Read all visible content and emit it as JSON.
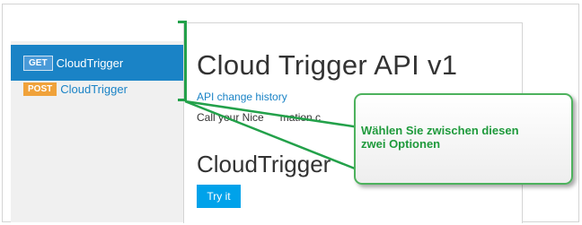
{
  "sidebar": {
    "items": [
      {
        "method": "GET",
        "label": "CloudTrigger"
      },
      {
        "method": "POST",
        "label": "CloudTrigger"
      }
    ]
  },
  "main": {
    "title": "Cloud Trigger API v1",
    "history_link": "API change history",
    "description_visible": "Call your Nice",
    "description_tail": "mation c",
    "operation_title": "CloudTrigger",
    "try_button": "Try it"
  },
  "callout": {
    "line1": "Wählen Sie zwischen diesen",
    "line2": "zwei Optionen"
  },
  "colors": {
    "accent": "#1a83c6",
    "get_badge": "#4a9ad8",
    "post_badge": "#f0a23a",
    "try_button": "#00a2ea",
    "annotation_green": "#23a14a"
  }
}
